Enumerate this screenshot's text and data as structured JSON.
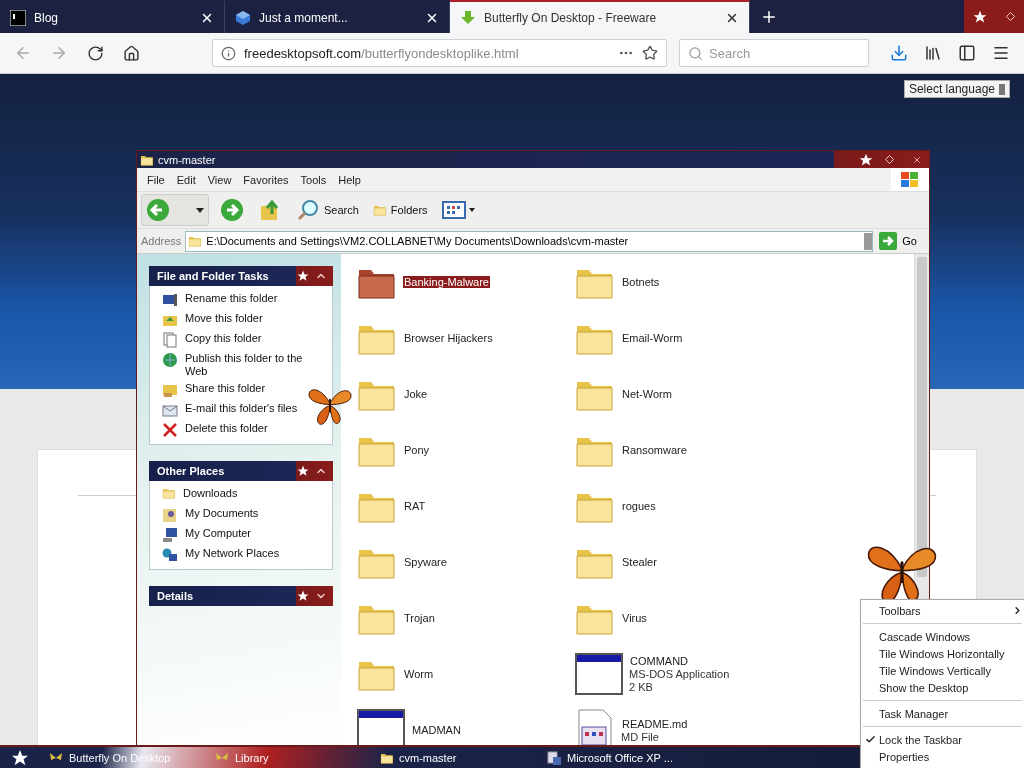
{
  "browser": {
    "tabs": [
      {
        "title": "Blog",
        "kind": "terminal",
        "selected": false
      },
      {
        "title": "Just a moment...",
        "kind": "cube",
        "selected": false
      },
      {
        "title": "Butterfly On Desktop - Freeware",
        "kind": "download",
        "selected": true
      }
    ],
    "url": {
      "domain": "freedesktopsoft.com",
      "path": "/butterflyondesktoplike.html"
    },
    "search": {
      "placeholder": "Search"
    }
  },
  "page": {
    "language_button": "Select language"
  },
  "explorer": {
    "title": "cvm-master",
    "menu": [
      "File",
      "Edit",
      "View",
      "Favorites",
      "Tools",
      "Help"
    ],
    "toolbar": {
      "buttons": [
        "Search",
        "Folders"
      ]
    },
    "address": {
      "label": "Address",
      "value": "E:\\Documents and Settings\\VM2.COLLABNET\\My Documents\\Downloads\\cvm-master",
      "go": "Go"
    },
    "task_panels": [
      {
        "title": "File and Folder Tasks",
        "expanded": true,
        "items": [
          {
            "label": "Rename this folder",
            "kind": "rename"
          },
          {
            "label": "Move this folder",
            "kind": "move"
          },
          {
            "label": "Copy this folder",
            "kind": "copy"
          },
          {
            "label": "Publish this folder to the Web",
            "kind": "publish"
          },
          {
            "label": "Share this folder",
            "kind": "share"
          },
          {
            "label": "E-mail this folder's files",
            "kind": "email"
          },
          {
            "label": "Delete this folder",
            "kind": "delete"
          }
        ]
      },
      {
        "title": "Other Places",
        "expanded": true,
        "items": [
          {
            "label": "Downloads",
            "kind": "folder"
          },
          {
            "label": "My Documents",
            "kind": "documents"
          },
          {
            "label": "My Computer",
            "kind": "computer"
          },
          {
            "label": "My Network Places",
            "kind": "network"
          }
        ]
      },
      {
        "title": "Details",
        "expanded": false
      }
    ],
    "files": [
      {
        "name": "Banking-Malware",
        "kind": "folder",
        "selected": true
      },
      {
        "name": "Botnets",
        "kind": "folder",
        "selected": false
      },
      {
        "name": "Browser Hijackers",
        "kind": "folder",
        "selected": false
      },
      {
        "name": "Email-Worm",
        "kind": "folder",
        "selected": false
      },
      {
        "name": "Joke",
        "kind": "folder",
        "selected": false
      },
      {
        "name": "Net-Worm",
        "kind": "folder",
        "selected": false
      },
      {
        "name": "Pony",
        "kind": "folder",
        "selected": false
      },
      {
        "name": "Ransomware",
        "kind": "folder",
        "selected": false
      },
      {
        "name": "RAT",
        "kind": "folder",
        "selected": false
      },
      {
        "name": "rogues",
        "kind": "folder",
        "selected": false
      },
      {
        "name": "Spyware",
        "kind": "folder",
        "selected": false
      },
      {
        "name": "Stealer",
        "kind": "folder",
        "selected": false
      },
      {
        "name": "Trojan",
        "kind": "folder",
        "selected": false
      },
      {
        "name": "Virus",
        "kind": "folder",
        "selected": false
      },
      {
        "name": "Worm",
        "kind": "folder",
        "selected": false
      },
      {
        "name": "COMMAND",
        "kind": "application",
        "details": [
          "MS-DOS Application",
          "2 KB"
        ],
        "selected": false
      },
      {
        "name": "MADMAN",
        "kind": "application",
        "selected": false
      },
      {
        "name": "README.md",
        "kind": "document",
        "details": [
          "MD File"
        ],
        "selected": false
      }
    ]
  },
  "taskbar": {
    "items": [
      {
        "label": "Butterfly On Desktop",
        "kind": "butterfly"
      },
      {
        "label": "Library",
        "kind": "butterfly"
      },
      {
        "label": "cvm-master",
        "kind": "folder"
      },
      {
        "label": "Microsoft Office XP ...",
        "kind": "office"
      }
    ]
  },
  "context_menu": {
    "items": [
      {
        "kind": "item",
        "label": "Toolbars",
        "submenu": true,
        "checked": false
      },
      {
        "kind": "separator"
      },
      {
        "kind": "item",
        "label": "Cascade Windows",
        "submenu": false,
        "checked": false
      },
      {
        "kind": "item",
        "label": "Tile Windows Horizontally",
        "submenu": false,
        "checked": false
      },
      {
        "kind": "item",
        "label": "Tile Windows Vertically",
        "submenu": false,
        "checked": false
      },
      {
        "kind": "item",
        "label": "Show the Desktop",
        "submenu": false,
        "checked": false
      },
      {
        "kind": "separator"
      },
      {
        "kind": "item",
        "label": "Task Manager",
        "submenu": false,
        "checked": false
      },
      {
        "kind": "separator"
      },
      {
        "kind": "item",
        "label": "Lock the Taskbar",
        "submenu": false,
        "checked": true
      },
      {
        "kind": "item",
        "label": "Properties",
        "submenu": false,
        "checked": false
      }
    ]
  }
}
